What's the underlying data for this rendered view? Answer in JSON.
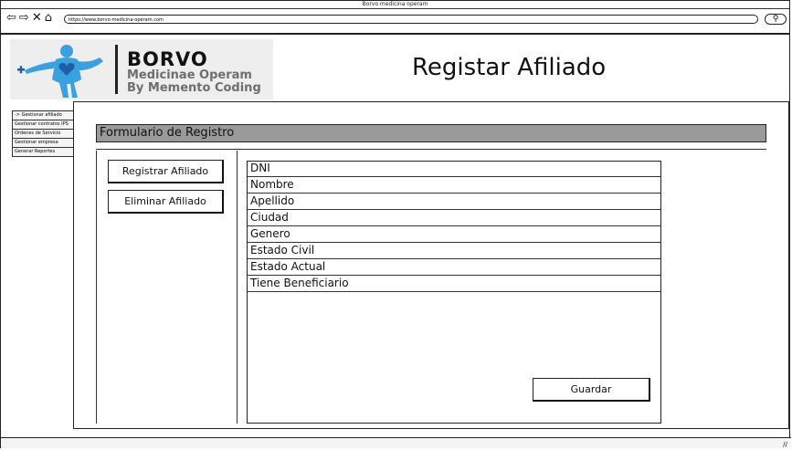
{
  "window": {
    "title": "Borvo medicina operam"
  },
  "addressbar": {
    "url": "https://www.borvo-medicina-operam.com"
  },
  "logo": {
    "line1": "BORVO",
    "line2": "Medicinae Operam",
    "line3": "By Memento Coding"
  },
  "page": {
    "title": "Registar Afiliado"
  },
  "sidebar": {
    "items": [
      {
        "label": "-> Gestionar afiliado"
      },
      {
        "label": "Gestionar contratos IPS"
      },
      {
        "label": "Ordenes de Servicio"
      },
      {
        "label": "Gestionar empresa"
      },
      {
        "label": "Generar Reportes"
      }
    ]
  },
  "form": {
    "header": "Formulario de Registro",
    "actions": {
      "register": "Registrar Afiliado",
      "delete": "Eliminar Afiliado"
    },
    "fields": [
      {
        "label": "DNI"
      },
      {
        "label": "Nombre"
      },
      {
        "label": "Apellido"
      },
      {
        "label": "Ciudad"
      },
      {
        "label": "Genero"
      },
      {
        "label": "Estado Civil"
      },
      {
        "label": "Estado Actual"
      },
      {
        "label": "Tiene Beneficiario"
      }
    ],
    "save": "Guardar"
  },
  "colors": {
    "logo_blue": "#3aa0e0",
    "logo_heart": "#1f5fa8",
    "header_bg": "#9a9a9a"
  }
}
